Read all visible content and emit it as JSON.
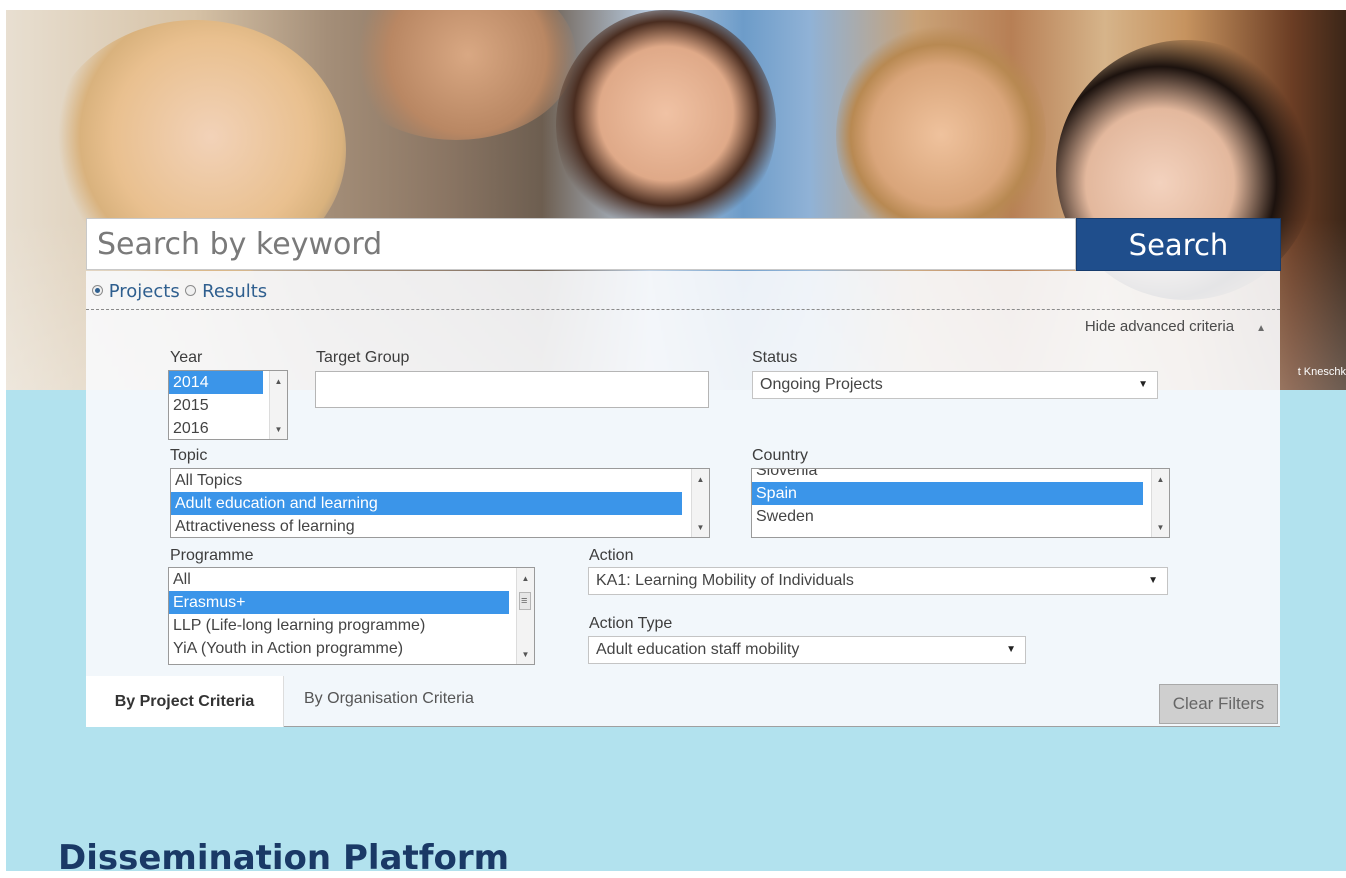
{
  "hero": {
    "photo_description_icon": "students-photo",
    "credit": "t Kneschk"
  },
  "search": {
    "placeholder": "Search by keyword",
    "button_label": "Search",
    "radios": [
      {
        "label": "Projects",
        "checked": true
      },
      {
        "label": "Results",
        "checked": false
      }
    ]
  },
  "advanced": {
    "toggle_label": "Hide advanced criteria",
    "year": {
      "label": "Year",
      "options": [
        {
          "label": "2014",
          "selected": true
        },
        {
          "label": "2015",
          "selected": false
        },
        {
          "label": "2016",
          "selected": false
        }
      ]
    },
    "target_group": {
      "label": "Target Group",
      "value": ""
    },
    "status": {
      "label": "Status",
      "value": "Ongoing Projects"
    },
    "topic": {
      "label": "Topic",
      "options": [
        {
          "label": "All Topics",
          "selected": false
        },
        {
          "label": "Adult education and learning",
          "selected": true
        },
        {
          "label": "Attractiveness of learning",
          "selected": false
        }
      ]
    },
    "country": {
      "label": "Country",
      "options": [
        {
          "label": "Slovenia",
          "selected": false
        },
        {
          "label": "Spain",
          "selected": true
        },
        {
          "label": "Sweden",
          "selected": false
        }
      ]
    },
    "programme": {
      "label": "Programme",
      "options": [
        {
          "label": "All",
          "selected": false
        },
        {
          "label": "Erasmus+",
          "selected": true
        },
        {
          "label": "LLP (Life-long learning programme)",
          "selected": false
        },
        {
          "label": "YiA (Youth in Action programme)",
          "selected": false
        }
      ]
    },
    "action": {
      "label": "Action",
      "value": "KA1: Learning Mobility of Individuals"
    },
    "action_type": {
      "label": "Action Type",
      "value": "Adult education staff mobility"
    }
  },
  "tabs": [
    {
      "label": "By Project Criteria",
      "active": true
    },
    {
      "label": "By Organisation Criteria",
      "active": false
    }
  ],
  "clear_filters_label": "Clear Filters",
  "page_heading": "Dissemination Platform",
  "colors": {
    "accent": "#1f4e8c",
    "selection": "#3b95e9",
    "background": "#b2e2ee",
    "heading": "#1a3966"
  }
}
